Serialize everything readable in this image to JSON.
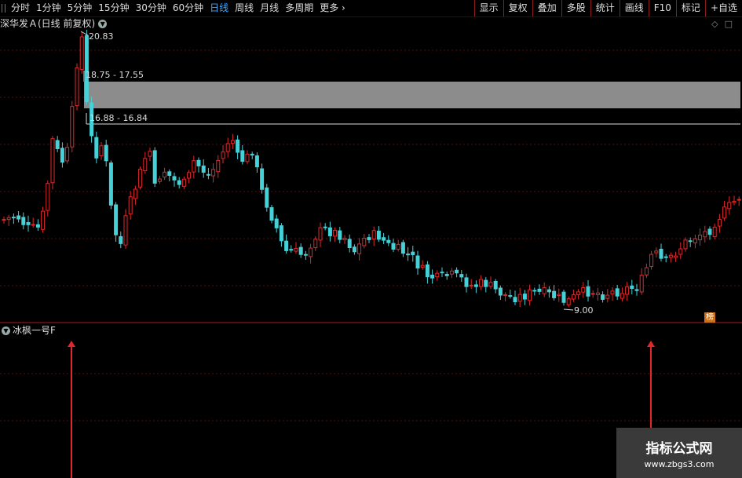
{
  "toolbar": {
    "periods": [
      "分时",
      "1分钟",
      "5分钟",
      "15分钟",
      "30分钟",
      "60分钟",
      "日线",
      "周线",
      "月线",
      "多周期",
      "更多"
    ],
    "active_period": "日线",
    "right_buttons": [
      "显示",
      "复权",
      "叠加",
      "多股",
      "统计",
      "画线",
      "F10",
      "标记",
      "+自选"
    ]
  },
  "chart": {
    "stock_title": "深华发Ａ(日线 前复权)",
    "high_label": "20.83",
    "low_label": "9.00",
    "gap_upper_label": "18.75 - 17.55",
    "gap_lower_label": "16.88 - 16.84",
    "badge": "榜",
    "colors": {
      "up": "#e0282a",
      "down": "#44d2d8",
      "gap": "#8c8c8c",
      "grid": "#5a1010",
      "arrow": "#e0282a"
    }
  },
  "indicator": {
    "name": "冰枫一号F",
    "signals": [
      "buy-signal-1",
      "buy-signal-2"
    ]
  },
  "watermark": {
    "title": "指标公式网",
    "url": "www.zbgs3.com"
  }
}
